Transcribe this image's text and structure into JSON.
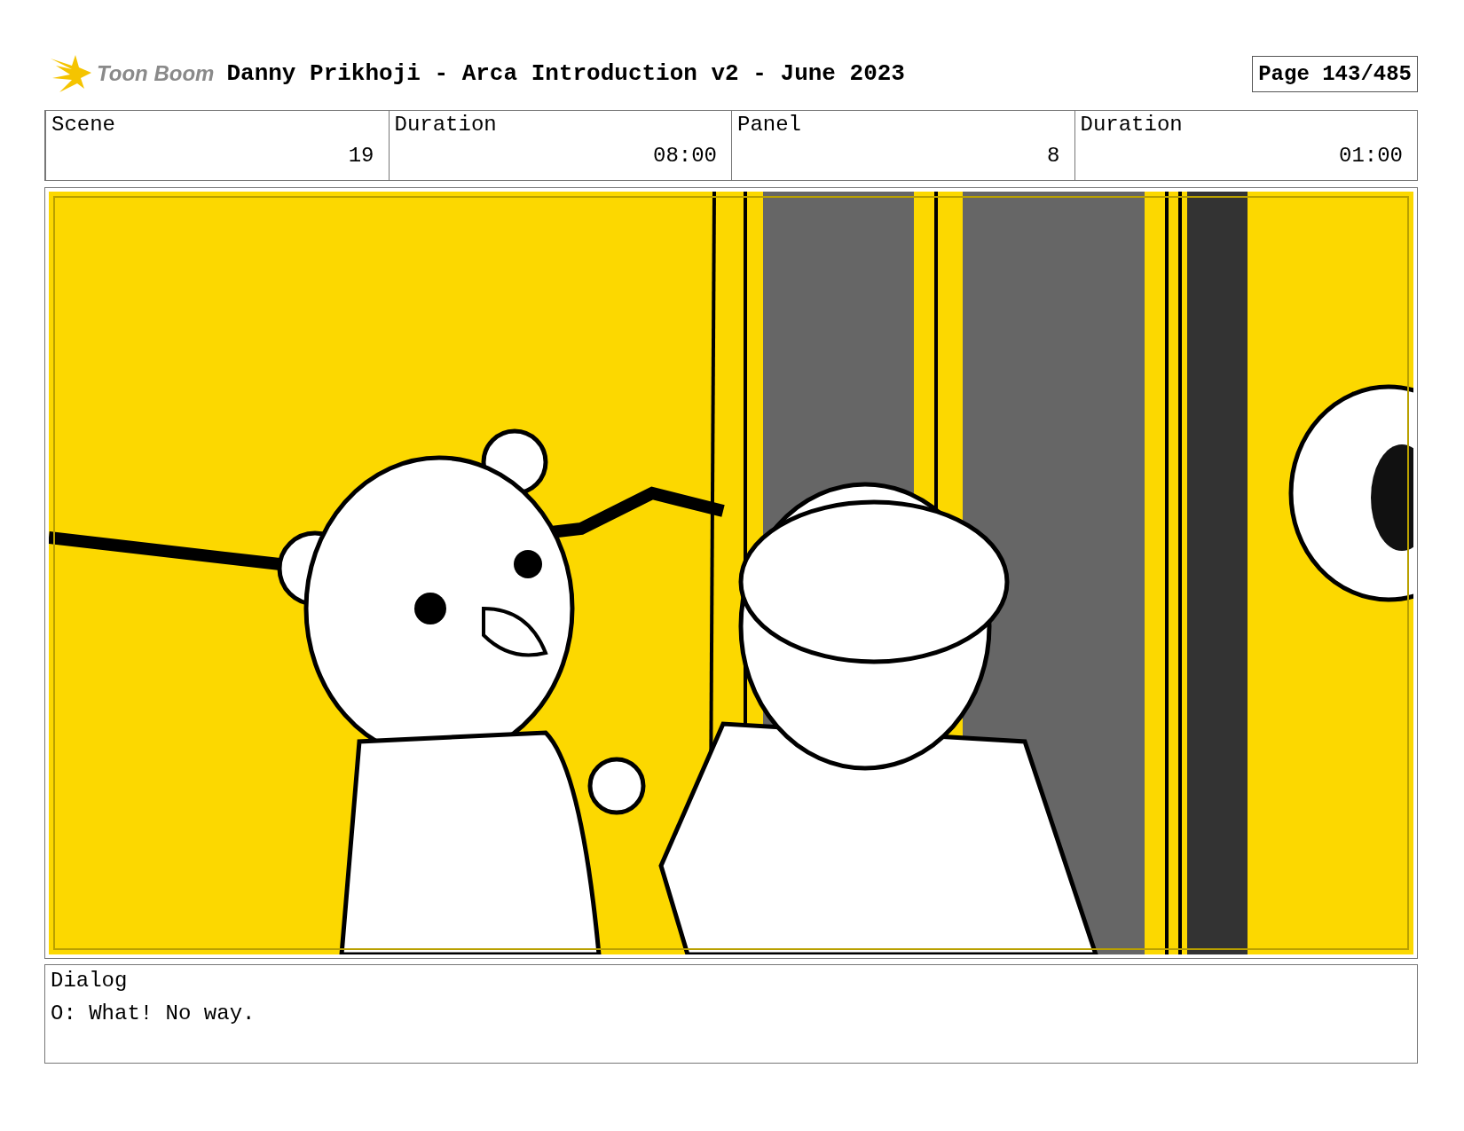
{
  "header": {
    "logo_text": "Toon Boom",
    "title": "Danny Prikhoji - Arca Introduction v2 - June 2023",
    "page": "Page 143/485"
  },
  "info": [
    {
      "label": "Scene",
      "value": "19"
    },
    {
      "label": "Duration",
      "value": "08:00"
    },
    {
      "label": "Panel",
      "value": "8"
    },
    {
      "label": "Duration",
      "value": "01:00"
    }
  ],
  "dialog": {
    "label": "Dialog",
    "text": "O: What! No way."
  }
}
